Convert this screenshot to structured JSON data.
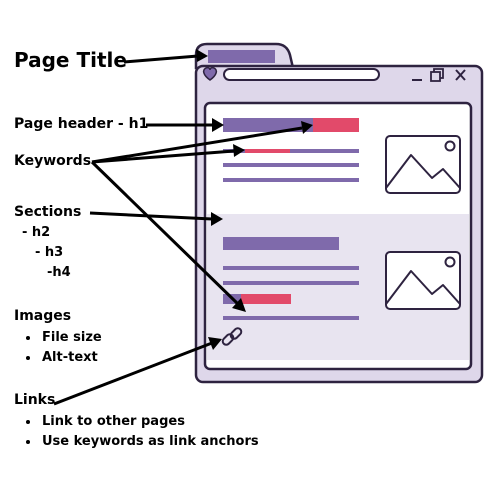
{
  "labels": {
    "page_title": "Page Title",
    "page_header": "Page header - h1",
    "keywords": "Keywords",
    "sections": "Sections",
    "sections_sub": [
      "- h2",
      "- h3",
      "-h4"
    ],
    "images": "Images",
    "images_bullets": [
      "File size",
      "Alt-text"
    ],
    "links": "Links",
    "links_bullets": [
      "Link to other pages",
      "Use keywords as link anchors"
    ]
  },
  "colors": {
    "outline": "#2e2340",
    "window_fill": "#ded7ea",
    "tab_bar": "#7f6aab",
    "text_bar": "#7f6aab",
    "keyword_highlight": "#e24a6a",
    "section_bg": "#e8e4f0",
    "page_bg": "#ffffff"
  },
  "icons": {
    "window_heart": "heart-icon",
    "minimize": "minimize-icon",
    "restore": "restore-icon",
    "close": "close-icon",
    "image_placeholder": "image-icon",
    "link": "link-icon"
  }
}
